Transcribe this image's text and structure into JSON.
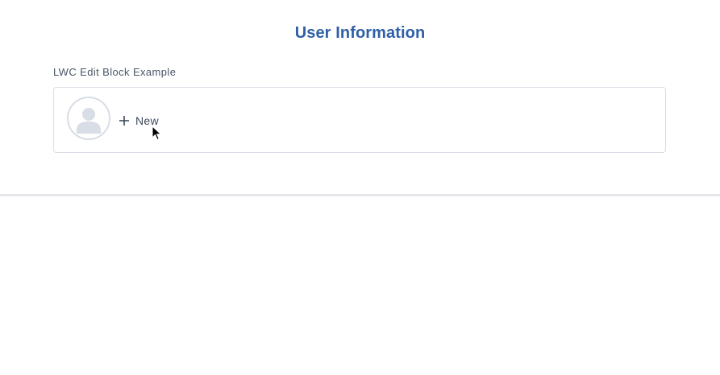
{
  "header": {
    "title": "User Information"
  },
  "section": {
    "label": "LWC Edit Block Example"
  },
  "card": {
    "avatar_icon": "user-avatar-icon",
    "new_button": {
      "icon": "plus-icon",
      "label": "New"
    }
  },
  "colors": {
    "title": "#2e5fa8",
    "text": "#3e4a5c",
    "border": "#d8dde6",
    "divider": "#e4e6ea"
  }
}
